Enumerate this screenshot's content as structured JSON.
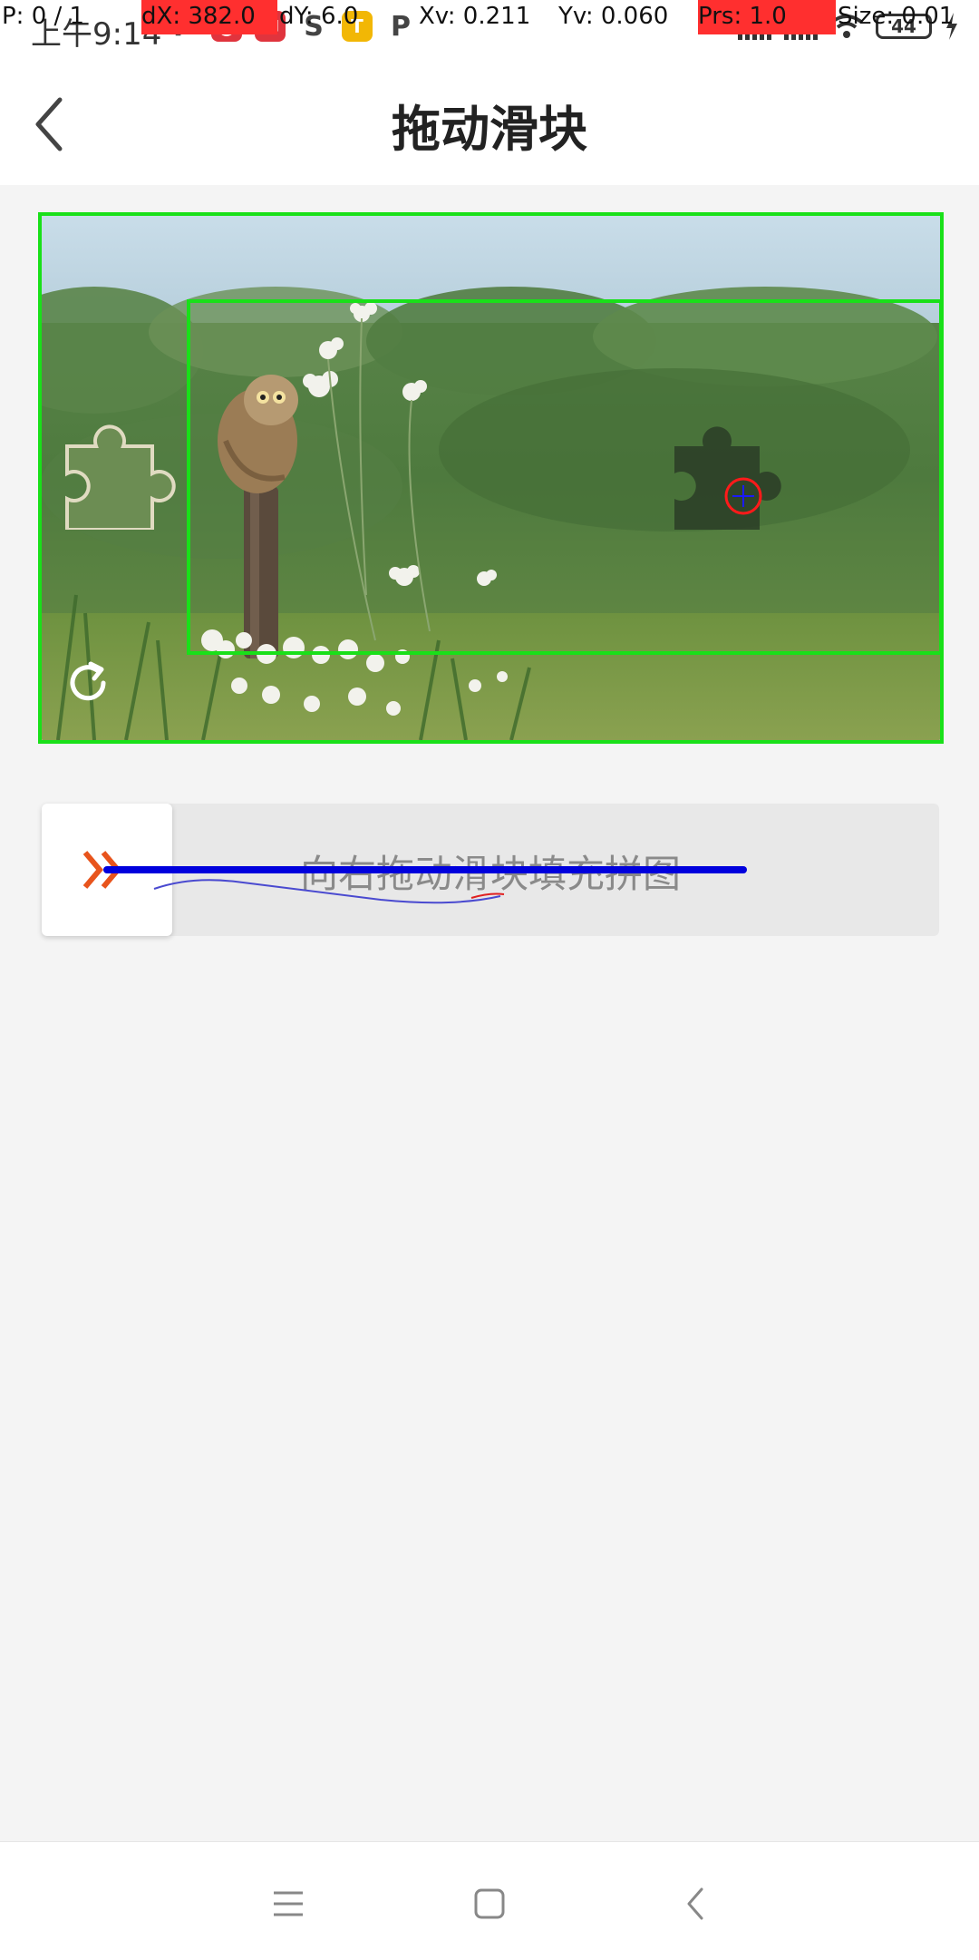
{
  "status_bar": {
    "time": "上午9:14",
    "apps": [
      {
        "icon": "parking-app-icon",
        "glyph": "P",
        "color": "#444444"
      },
      {
        "icon": "red-app-icon",
        "glyph": "●",
        "color": "#e0343d"
      },
      {
        "icon": "shopping-app-icon",
        "glyph": "✉",
        "color": "#e0343d"
      },
      {
        "icon": "sync-app-icon",
        "glyph": "S",
        "color": "#444444"
      },
      {
        "icon": "taxi-app-icon",
        "glyph": "🚕",
        "color": "#f2b705"
      },
      {
        "icon": "parking-app-icon-2",
        "glyph": "P",
        "color": "#444444"
      }
    ],
    "battery": "44"
  },
  "debug_overlay": {
    "pointer": "P: 0 / 1",
    "dx": "dX: 382.0",
    "dy": "dY: 6.0",
    "xv": "Xv: 0.211",
    "yv": "Yv: 0.060",
    "prs": "Prs: 1.0",
    "size": "Size: 0.01"
  },
  "header": {
    "title": "拖动滑块"
  },
  "captcha": {
    "piece_position": 0,
    "slider_hint": "向右拖动滑块填充拼图",
    "icons": {
      "refresh": "refresh-icon",
      "handle": "double-chevron-right-icon"
    },
    "colors": {
      "handle_arrow": "#e8541c",
      "detection_box": "#19e019",
      "trajectory": "#0000dd"
    }
  },
  "nav": {
    "icons": [
      "menu-icon",
      "home-icon",
      "back-icon"
    ]
  }
}
